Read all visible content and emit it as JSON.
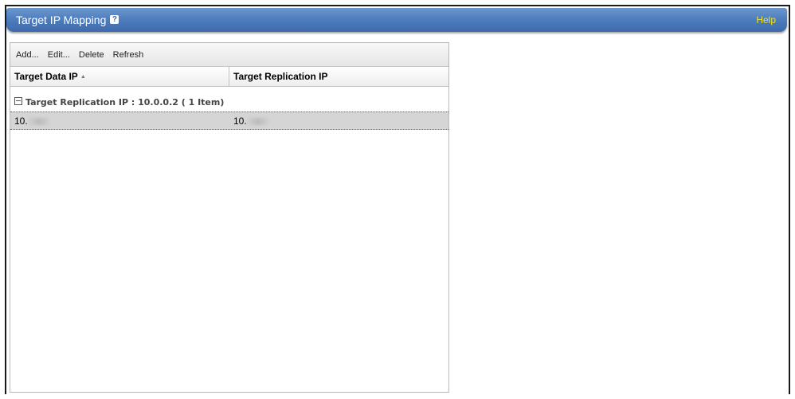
{
  "header": {
    "title": "Target IP Mapping",
    "info_icon": "?",
    "help_label": "Help"
  },
  "toolbar": {
    "add_label": "Add...",
    "edit_label": "Edit...",
    "delete_label": "Delete",
    "refresh_label": "Refresh"
  },
  "table": {
    "columns": [
      {
        "label": "Target Data IP",
        "sort": "ascending"
      },
      {
        "label": "Target Replication IP"
      }
    ],
    "group": {
      "label": "Target Replication IP : 10.0.0.2 ( 1 Item)",
      "expanded": true
    },
    "rows": [
      {
        "data_ip": "10.",
        "replication_ip": "10."
      }
    ],
    "selected_row_color": "#d5d5d5"
  },
  "colors": {
    "title_bar": "#4f7fbf",
    "help_link": "#f6e21e"
  }
}
